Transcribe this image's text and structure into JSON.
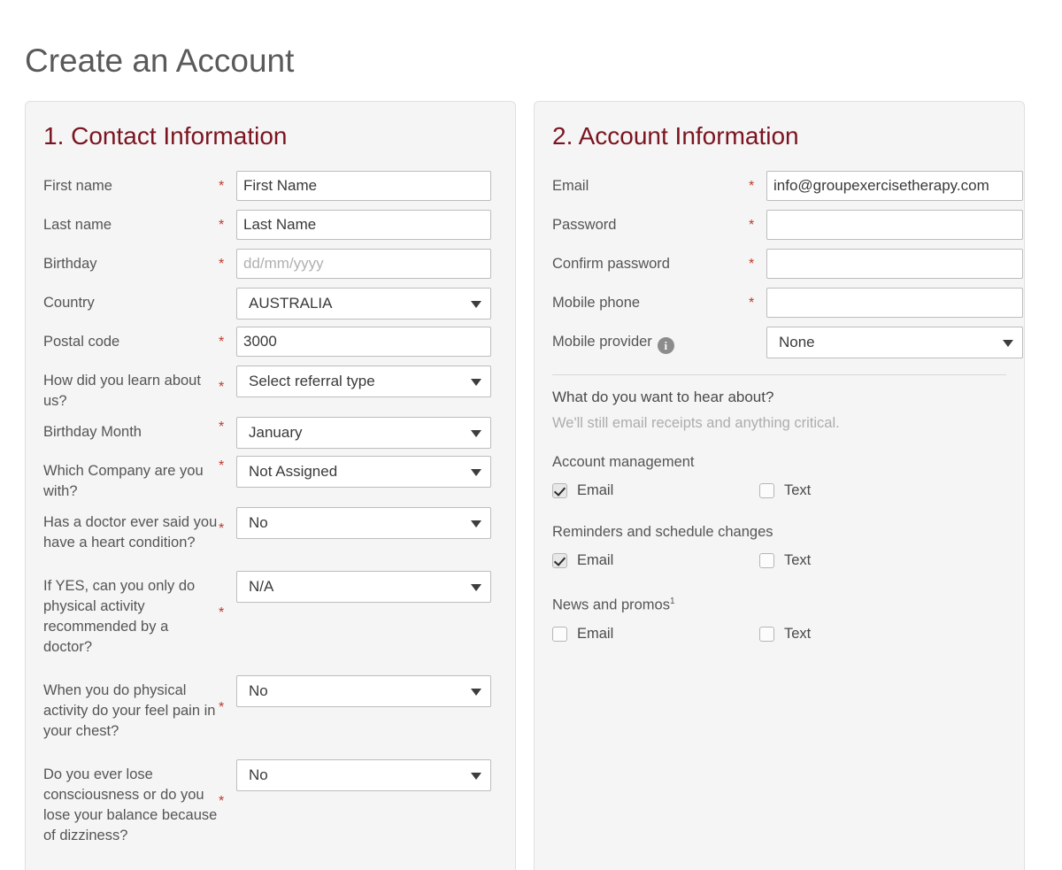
{
  "page": {
    "title": "Create an Account"
  },
  "colors": {
    "panel_heading": "#7b1420",
    "required_asterisk": "#c0392b",
    "page_background": "#ffffff",
    "panel_background": "#f5f5f5",
    "panel_border": "#e0e0e0"
  },
  "contact_panel": {
    "heading": "1. Contact Information",
    "fields": [
      {
        "label": "First name",
        "required": "*",
        "type": "text",
        "value": "First Name",
        "is_placeholder": false
      },
      {
        "label": "Last name",
        "required": "*",
        "type": "text",
        "value": "Last Name",
        "is_placeholder": false
      },
      {
        "label": "Birthday",
        "required": "*",
        "type": "text",
        "value": "dd/mm/yyyy",
        "is_placeholder": true
      },
      {
        "label": "Country",
        "required": "",
        "type": "select",
        "value": "AUSTRALIA"
      },
      {
        "label": "Postal code",
        "required": "*",
        "type": "text",
        "value": "3000",
        "is_placeholder": false
      },
      {
        "label": "How did you learn about us?",
        "required": "*",
        "type": "select",
        "value": "Select referral type"
      },
      {
        "label": "Birthday Month",
        "required": "*",
        "type": "select",
        "value": "January"
      },
      {
        "label": "Which Company are you with?",
        "required": "*",
        "type": "select",
        "value": "Not Assigned"
      },
      {
        "label": "Has a doctor ever said you have a heart condition?",
        "required": "*",
        "type": "select",
        "value": "No"
      },
      {
        "label": "If YES, can you only do physical activity recommended by a doctor?",
        "required": "*",
        "type": "select",
        "value": "N/A"
      },
      {
        "label": "When you do physical activity do your feel pain in your chest?",
        "required": "*",
        "type": "select",
        "value": "No"
      },
      {
        "label": "Do you ever lose consciousness or do you lose your balance because of dizziness?",
        "required": "*",
        "type": "select",
        "value": "No"
      }
    ]
  },
  "account_panel": {
    "heading": "2. Account Information",
    "fields": [
      {
        "label": "Email",
        "required": "*",
        "type": "text",
        "value": "info@groupexercisetherapy.com",
        "is_placeholder": false
      },
      {
        "label": "Password",
        "required": "*",
        "type": "password",
        "value": "",
        "is_placeholder": false
      },
      {
        "label": "Confirm password",
        "required": "*",
        "type": "password",
        "value": "",
        "is_placeholder": false
      },
      {
        "label": "Mobile phone",
        "required": "*",
        "type": "text",
        "value": "",
        "is_placeholder": false
      },
      {
        "label": "Mobile provider",
        "required": "",
        "type": "select",
        "value": "None",
        "info_icon": "info-icon",
        "info_glyph": "i"
      }
    ],
    "preferences": {
      "heading": "What do you want to hear about?",
      "subtext": "We'll still email receipts and anything critical.",
      "groups": [
        {
          "label": "Account management",
          "options": [
            {
              "label": "Email",
              "checked": true
            },
            {
              "label": "Text",
              "checked": false
            }
          ]
        },
        {
          "label": "Reminders and schedule changes",
          "options": [
            {
              "label": "Email",
              "checked": true
            },
            {
              "label": "Text",
              "checked": false
            }
          ]
        },
        {
          "label": "News and promos",
          "footnote": "1",
          "options": [
            {
              "label": "Email",
              "checked": false
            },
            {
              "label": "Text",
              "checked": false
            }
          ]
        }
      ]
    }
  }
}
